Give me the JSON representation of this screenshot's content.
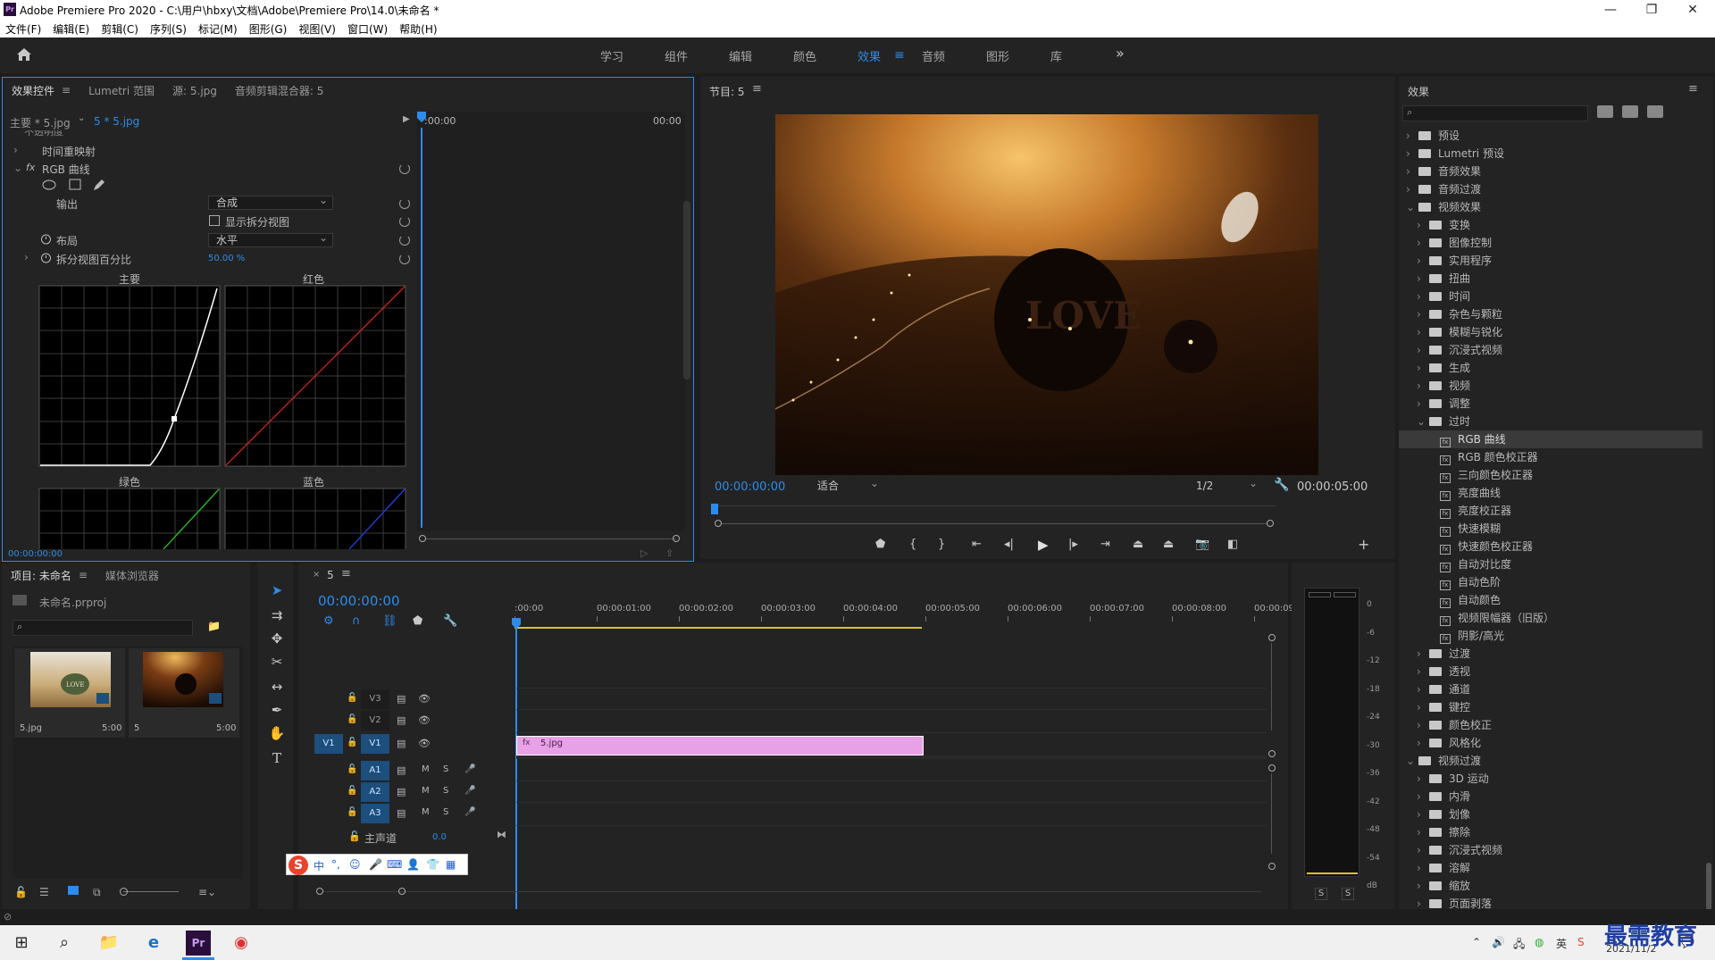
{
  "app": {
    "title": "Adobe Premiere Pro 2020 - C:\\用户\\hbxy\\文档\\Adobe\\Premiere Pro\\14.0\\未命名 *",
    "logo_text": "Pr"
  },
  "menu": [
    "文件(F)",
    "编辑(E)",
    "剪辑(C)",
    "序列(S)",
    "标记(M)",
    "图形(G)",
    "视图(V)",
    "窗口(W)",
    "帮助(H)"
  ],
  "workspaces": [
    "学习",
    "组件",
    "编辑",
    "颜色",
    "效果",
    "音频",
    "图形",
    "库"
  ],
  "active_workspace": "效果",
  "effect_controls": {
    "tabs": [
      "效果控件",
      "Lumetri 范围",
      "源: 5.jpg",
      "音频剪辑混合器: 5"
    ],
    "master_label": "主要 * 5.jpg",
    "clip_label": "5 * 5.jpg",
    "time_start": ":00:00",
    "time_end": "00:00",
    "cut_item": "不透明度",
    "time_remap": "时间重映射",
    "rgb_curves": "RGB 曲线",
    "output_label": "输出",
    "output_value": "合成",
    "show_split_label": "显示拆分视图",
    "layout_label": "布局",
    "layout_value": "水平",
    "split_pct_label": "拆分视图百分比",
    "split_pct_value": "50.00 %",
    "curve_master": "主要",
    "curve_red": "红色",
    "curve_green": "绿色",
    "curve_blue": "蓝色",
    "timecode": "00:00:00:00"
  },
  "program": {
    "title": "节目: 5",
    "timecode": "00:00:00:00",
    "fit": "适合",
    "quality": "1/2",
    "duration": "00:00:05:00",
    "image_text": "LOVE"
  },
  "project": {
    "tabs": [
      "项目: 未命名",
      "媒体浏览器"
    ],
    "file": "未命名.prproj",
    "items": [
      {
        "name": "5.jpg",
        "duration": "5:00"
      },
      {
        "name": "5",
        "duration": "5:00"
      }
    ],
    "thumb_text": "LOVE"
  },
  "timeline": {
    "tab": "5",
    "timecode": "00:00:00:00",
    "ruler": [
      ":00:00",
      "00:00:01:00",
      "00:00:02:00",
      "00:00:03:00",
      "00:00:04:00",
      "00:00:05:00",
      "00:00:06:00",
      "00:00:07:00",
      "00:00:08:00",
      "00:00:09:"
    ],
    "video_tracks": [
      "V3",
      "V2",
      "V1"
    ],
    "audio_tracks": [
      "A1",
      "A2",
      "A3"
    ],
    "source_patch": "V1",
    "master_label": "主声道",
    "master_value": "0.0",
    "clip_name": "5.jpg",
    "mute_label": "M",
    "solo_label": "S"
  },
  "meter": {
    "scale": [
      "0",
      "-6",
      "-12",
      "-18",
      "-24",
      "-30",
      "-36",
      "-42",
      "-48",
      "-54",
      "dB"
    ],
    "solo": [
      "S",
      "S"
    ]
  },
  "effects_panel": {
    "title": "效果",
    "tree": [
      {
        "label": "预设",
        "depth": 0,
        "type": "folder",
        "open": false
      },
      {
        "label": "Lumetri 预设",
        "depth": 0,
        "type": "folder",
        "open": false
      },
      {
        "label": "音频效果",
        "depth": 0,
        "type": "folder",
        "open": false
      },
      {
        "label": "音频过渡",
        "depth": 0,
        "type": "folder",
        "open": false
      },
      {
        "label": "视频效果",
        "depth": 0,
        "type": "folder",
        "open": true
      },
      {
        "label": "变换",
        "depth": 1,
        "type": "folder",
        "open": false
      },
      {
        "label": "图像控制",
        "depth": 1,
        "type": "folder",
        "open": false
      },
      {
        "label": "实用程序",
        "depth": 1,
        "type": "folder",
        "open": false
      },
      {
        "label": "扭曲",
        "depth": 1,
        "type": "folder",
        "open": false
      },
      {
        "label": "时间",
        "depth": 1,
        "type": "folder",
        "open": false
      },
      {
        "label": "杂色与颗粒",
        "depth": 1,
        "type": "folder",
        "open": false
      },
      {
        "label": "模糊与锐化",
        "depth": 1,
        "type": "folder",
        "open": false
      },
      {
        "label": "沉浸式视频",
        "depth": 1,
        "type": "folder",
        "open": false
      },
      {
        "label": "生成",
        "depth": 1,
        "type": "folder",
        "open": false
      },
      {
        "label": "视频",
        "depth": 1,
        "type": "folder",
        "open": false
      },
      {
        "label": "调整",
        "depth": 1,
        "type": "folder",
        "open": false
      },
      {
        "label": "过时",
        "depth": 1,
        "type": "folder",
        "open": true
      },
      {
        "label": "RGB 曲线",
        "depth": 2,
        "type": "effect",
        "selected": true
      },
      {
        "label": "RGB 颜色校正器",
        "depth": 2,
        "type": "effect"
      },
      {
        "label": "三向颜色校正器",
        "depth": 2,
        "type": "effect"
      },
      {
        "label": "亮度曲线",
        "depth": 2,
        "type": "effect"
      },
      {
        "label": "亮度校正器",
        "depth": 2,
        "type": "effect"
      },
      {
        "label": "快速模糊",
        "depth": 2,
        "type": "effect"
      },
      {
        "label": "快速颜色校正器",
        "depth": 2,
        "type": "effect"
      },
      {
        "label": "自动对比度",
        "depth": 2,
        "type": "effect"
      },
      {
        "label": "自动色阶",
        "depth": 2,
        "type": "effect"
      },
      {
        "label": "自动颜色",
        "depth": 2,
        "type": "effect"
      },
      {
        "label": "视频限幅器（旧版）",
        "depth": 2,
        "type": "effect"
      },
      {
        "label": "阴影/高光",
        "depth": 2,
        "type": "effect"
      },
      {
        "label": "过渡",
        "depth": 1,
        "type": "folder",
        "open": false
      },
      {
        "label": "透视",
        "depth": 1,
        "type": "folder",
        "open": false
      },
      {
        "label": "通道",
        "depth": 1,
        "type": "folder",
        "open": false
      },
      {
        "label": "键控",
        "depth": 1,
        "type": "folder",
        "open": false
      },
      {
        "label": "颜色校正",
        "depth": 1,
        "type": "folder",
        "open": false
      },
      {
        "label": "风格化",
        "depth": 1,
        "type": "folder",
        "open": false
      },
      {
        "label": "视频过渡",
        "depth": 0,
        "type": "folder",
        "open": true
      },
      {
        "label": "3D 运动",
        "depth": 1,
        "type": "folder",
        "open": false
      },
      {
        "label": "内滑",
        "depth": 1,
        "type": "folder",
        "open": false
      },
      {
        "label": "划像",
        "depth": 1,
        "type": "folder",
        "open": false
      },
      {
        "label": "擦除",
        "depth": 1,
        "type": "folder",
        "open": false
      },
      {
        "label": "沉浸式视频",
        "depth": 1,
        "type": "folder",
        "open": false
      },
      {
        "label": "溶解",
        "depth": 1,
        "type": "folder",
        "open": false
      },
      {
        "label": "缩放",
        "depth": 1,
        "type": "folder",
        "open": false
      },
      {
        "label": "页面剥落",
        "depth": 1,
        "type": "folder",
        "open": false
      }
    ]
  },
  "taskbar": {
    "date": "2021/11/2",
    "watermark": "最需教育"
  },
  "colors": {
    "accent": "#2d8ceb",
    "clip": "#e7a1e6",
    "panel": "#232323",
    "selection": "#3a3a3a"
  }
}
